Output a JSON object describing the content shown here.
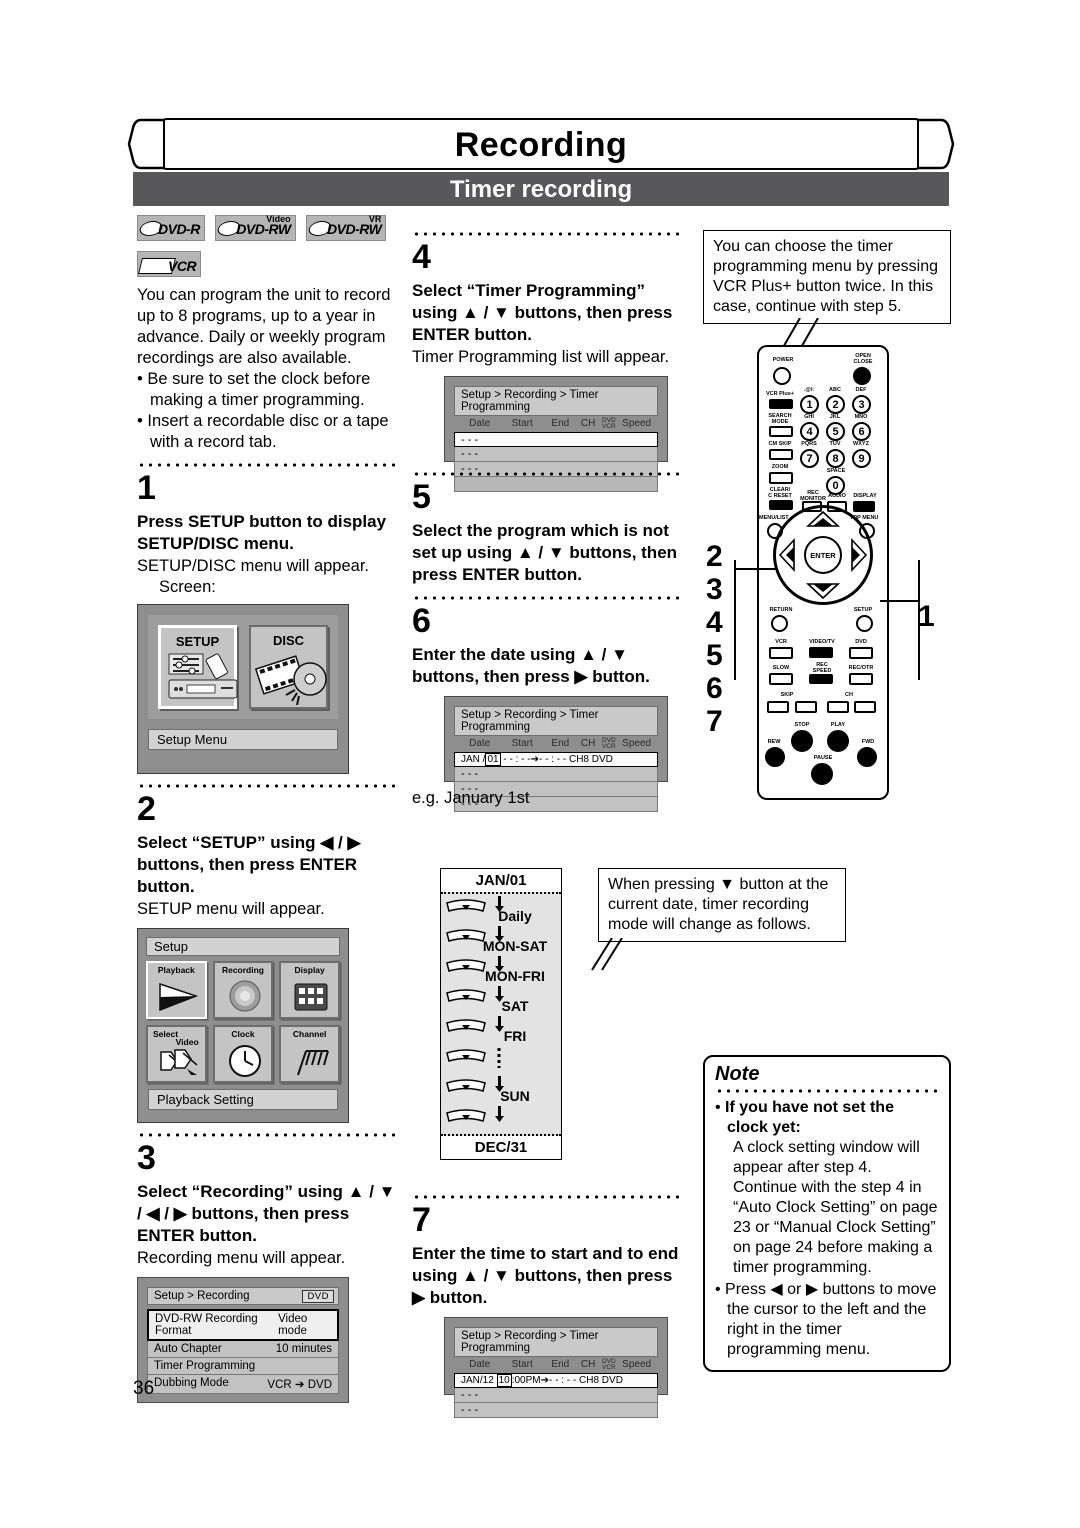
{
  "page": {
    "title": "Recording",
    "subtitle": "Timer recording",
    "number": "36"
  },
  "media_logos": [
    {
      "name": "DVD-R",
      "sup": ""
    },
    {
      "name": "DVD-RW",
      "sup": "Video"
    },
    {
      "name": "DVD-RW",
      "sup": "VR"
    },
    {
      "name": "VCR",
      "sup": ""
    }
  ],
  "intro": {
    "paragraph": "You can program the unit to record up to 8 programs, up to a year in advance. Daily or weekly program recordings are also available.",
    "bullets": [
      "Be sure to set the clock before making a timer programming.",
      "Insert a recordable disc or a tape with a record tab."
    ]
  },
  "steps": {
    "s1": {
      "num": "1",
      "instruction": "Press SETUP button to display SETUP/DISC menu.",
      "result": "SETUP/DISC menu will appear.",
      "screen_label": "Screen:"
    },
    "s2": {
      "num": "2",
      "instruction": "Select “SETUP” using ◀ / ▶ buttons, then press ENTER button.",
      "result": "SETUP menu will appear."
    },
    "s3": {
      "num": "3",
      "instruction": "Select “Recording” using ▲ / ▼ / ◀ / ▶ buttons, then press ENTER button.",
      "result": "Recording menu will appear."
    },
    "s4": {
      "num": "4",
      "instruction": "Select “Timer Programming” using ▲ / ▼ buttons, then press ENTER button.",
      "result": "Timer Programming list will appear."
    },
    "s5": {
      "num": "5",
      "instruction": "Select the program which is not set up using ▲ / ▼ buttons, then press ENTER button."
    },
    "s6": {
      "num": "6",
      "instruction": "Enter the date using ▲ / ▼ buttons, then press ▶ button.",
      "example": "e.g. January 1st"
    },
    "s7": {
      "num": "7",
      "instruction": "Enter the time to start and to end using ▲ / ▼ buttons, then press ▶ button."
    }
  },
  "setup_disc_screen": {
    "tiles": [
      {
        "label": "SETUP",
        "selected": true
      },
      {
        "label": "DISC",
        "selected": false
      }
    ],
    "footer": "Setup Menu"
  },
  "setup_screen": {
    "title": "Setup",
    "tiles": [
      {
        "label": "Playback",
        "selected": true
      },
      {
        "label": "Recording",
        "selected": false
      },
      {
        "label": "Display",
        "selected": false
      },
      {
        "label": "Select",
        "label2": "Video",
        "selected": false
      },
      {
        "label": "Clock",
        "selected": false
      },
      {
        "label": "Channel",
        "selected": false
      }
    ],
    "footer": "Playback Setting"
  },
  "recording_screen": {
    "title": "Setup > Recording",
    "tag": "DVD",
    "rows": [
      {
        "name": "DVD-RW Recording Format",
        "value": "Video mode",
        "selected": true
      },
      {
        "name": "Auto Chapter",
        "value": "10 minutes",
        "selected": false
      },
      {
        "name": "Timer Programming",
        "value": "",
        "selected": false
      },
      {
        "name": "Dubbing Mode",
        "value": "VCR ➔ DVD",
        "selected": false
      }
    ]
  },
  "timer_list_screen": {
    "title": "Setup > Recording > Timer Programming",
    "headers": [
      "Date",
      "Start",
      "End",
      "CH",
      "DVD/VCR",
      "Speed"
    ],
    "rows": [
      "- - -",
      "- - -",
      "- - -",
      ""
    ]
  },
  "timer_date_screen": {
    "title": "Setup > Recording > Timer Programming",
    "headers": [
      "Date",
      "Start",
      "End",
      "CH",
      "DVD/VCR",
      "Speed"
    ],
    "entry": {
      "date_month": "JAN /",
      "date_day": "01",
      "start": "- - : - -",
      "arrow": "➔",
      "end": "- - : - -",
      "ch": "CH8",
      "media": "DVD"
    },
    "rows": [
      "- - -",
      "- - -",
      "- - -"
    ]
  },
  "timer_time_screen": {
    "title": "Setup > Recording > Timer Programming",
    "headers": [
      "Date",
      "Start",
      "End",
      "CH",
      "DVD/VCR",
      "Speed"
    ],
    "entry": {
      "date": "JAN/12",
      "hour": "10",
      "rest": ":00PM",
      "arrow": "➔",
      "end": "- - : - -",
      "ch": "CH8",
      "media": "DVD"
    },
    "rows": [
      "- - -",
      "- - -"
    ]
  },
  "callouts": {
    "vcr_plus": "You can choose the timer programming menu by pressing VCR Plus+ button twice. In this case, continue with step 5.",
    "down_button": "When pressing ▼ button at the current date, timer recording mode will change as follows."
  },
  "cycle_diagram": {
    "top": "JAN/01",
    "items": [
      "Daily",
      "MON-SAT",
      "MON-FRI",
      "SAT",
      "FRI",
      "SUN"
    ],
    "bottom": "DEC/31"
  },
  "note": {
    "title": "Note",
    "items": [
      {
        "bold": "If you have not set the clock yet:",
        "text": "A clock setting window will appear after step 4.  Continue with the step 4 in “Auto Clock Setting” on page 23 or “Manual Clock Setting” on page 24 before making a timer programming."
      },
      {
        "bold": "",
        "text": "Press ◀ or ▶ buttons to move the cursor to the left and the right in the timer programming menu."
      }
    ]
  },
  "remote": {
    "step_markers": [
      "2",
      "3",
      "4",
      "5",
      "6",
      "7"
    ],
    "setup_marker": "1",
    "buttons": [
      "POWER",
      "OPEN CLOSE",
      "VCR Plus+",
      "SEARCH MODE",
      "CM SKIP",
      "ZOOM",
      "CLEAR/ C RESET",
      "REC MONITOR",
      "AUDIO",
      "DISPLAY",
      "MENU/LIST",
      "TOP MENU",
      "ENTER",
      "RETURN",
      "SETUP",
      "VCR",
      "VIDEO/TV",
      "DVD",
      "SLOW",
      "REC SPEED",
      "REC/OTR",
      "SKIP",
      "CH",
      "STOP",
      "PLAY",
      "REW",
      "FWD",
      "PAUSE"
    ],
    "keypad": [
      {
        "num": "1",
        "letters": ".@/:"
      },
      {
        "num": "2",
        "letters": "ABC"
      },
      {
        "num": "3",
        "letters": "DEF"
      },
      {
        "num": "4",
        "letters": "GHI"
      },
      {
        "num": "5",
        "letters": "JKL"
      },
      {
        "num": "6",
        "letters": "MNO"
      },
      {
        "num": "7",
        "letters": "PQRS"
      },
      {
        "num": "8",
        "letters": "TUV"
      },
      {
        "num": "9",
        "letters": "WXYZ"
      },
      {
        "num": "0",
        "letters": "SPACE"
      }
    ]
  }
}
